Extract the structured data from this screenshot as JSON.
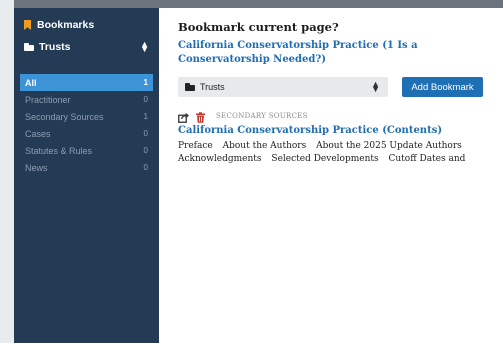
{
  "sidebar": {
    "title": "Bookmarks",
    "folder": "Trusts",
    "categories": [
      {
        "label": "All",
        "count": "1"
      },
      {
        "label": "Practitioner",
        "count": "0"
      },
      {
        "label": "Secondary Sources",
        "count": "1"
      },
      {
        "label": "Cases",
        "count": "0"
      },
      {
        "label": "Statutes & Rules",
        "count": "0"
      },
      {
        "label": "News",
        "count": "0"
      }
    ]
  },
  "main": {
    "heading": "Bookmark current page?",
    "current_page": "California Conservatorship Practice (1 Is a Conservatorship Needed?)",
    "folder_select": "Trusts",
    "add_button": "Add Bookmark"
  },
  "bookmark": {
    "source_type": "SECONDARY SOURCES",
    "title": "California Conservatorship Practice (Contents)",
    "toc_line1": [
      "Preface",
      "About the Authors",
      "About the 2025 Update Authors"
    ],
    "toc_line2": [
      "Acknowledgments",
      "Selected Developments",
      "Cutoff Dates and"
    ]
  },
  "colors": {
    "sidebar_bg": "#233b55",
    "active_item": "#3c93d6",
    "accent_link": "#1f6db0",
    "button": "#1f6fb5",
    "bookmark_icon": "#f29b1d",
    "delete_icon": "#c0392b"
  },
  "icons": [
    "bookmark-icon",
    "folder-icon",
    "chevron-updown-icon",
    "share-icon",
    "trash-icon"
  ]
}
